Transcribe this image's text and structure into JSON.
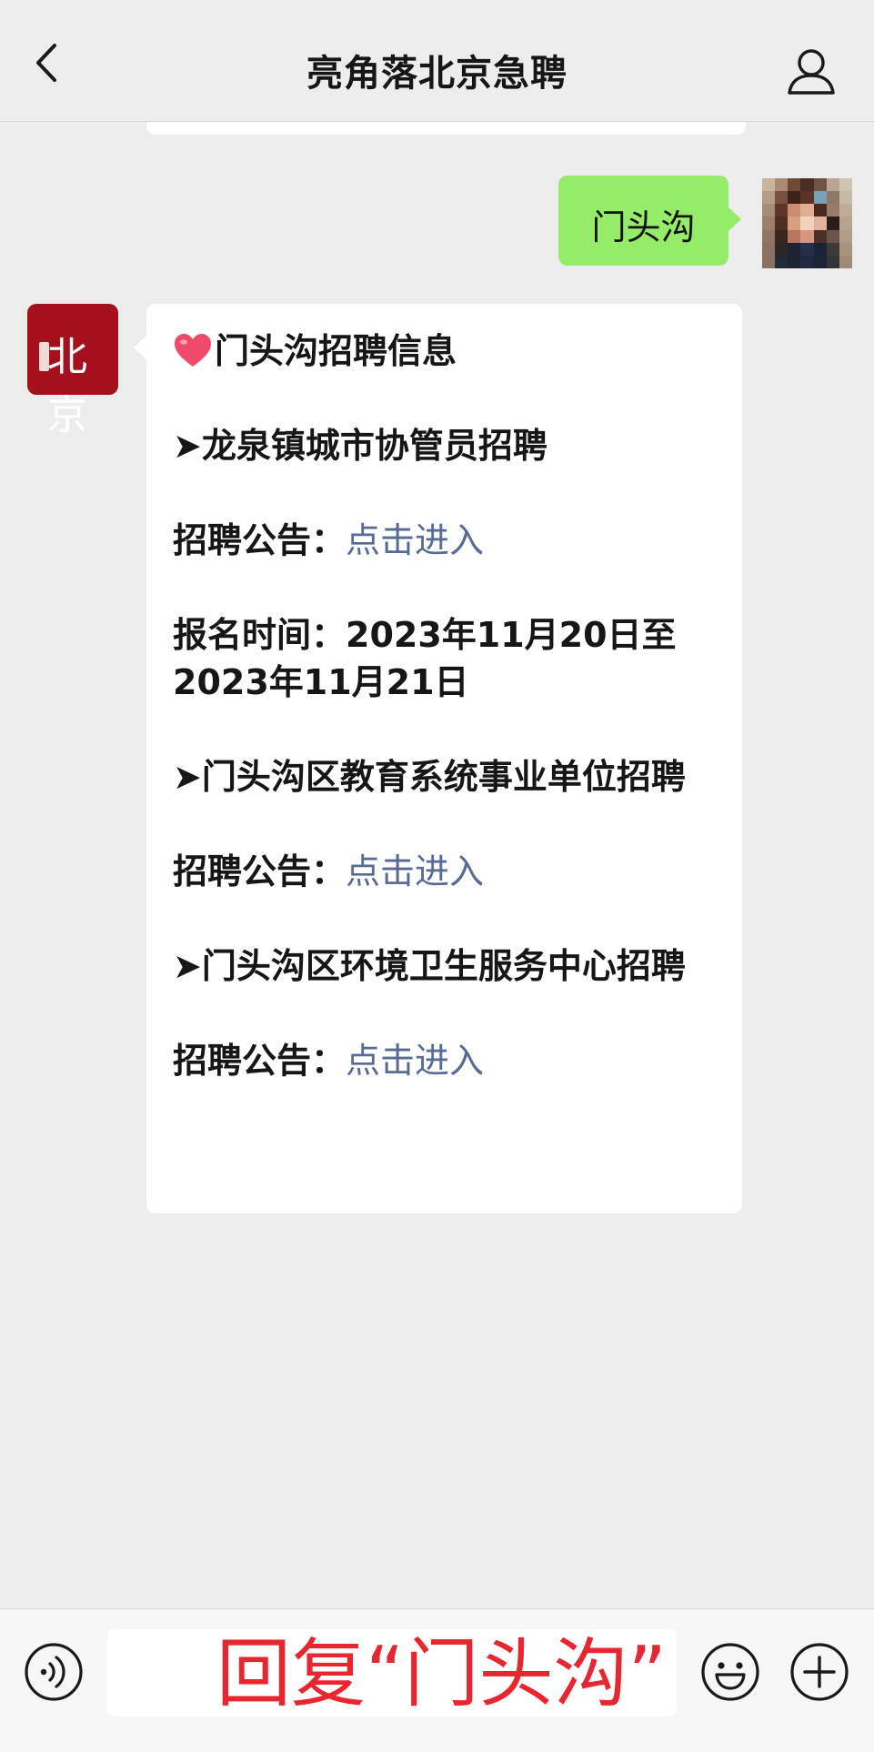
{
  "header": {
    "title": "亮角落北京急聘",
    "back_icon": "chevron-left-icon",
    "profile_icon": "person-icon"
  },
  "outgoing_message": {
    "text": "门头沟",
    "bubble_color": "#95ec69"
  },
  "bot_avatar": {
    "logo_text": "北京",
    "color": "#a4101c"
  },
  "incoming_message": {
    "title_icon": "heart-icon",
    "title": "门头沟招聘信息",
    "section1_heading": "➤龙泉镇城市协管员招聘",
    "section1_notice_label": "招聘公告：",
    "section1_notice_link": "点击进入",
    "section1_signup": "报名时间：2023年11月20日至2023年11月21日",
    "section2_heading": "➤门头沟区教育系统事业单位招聘",
    "section2_notice_label": "招聘公告：",
    "section2_notice_link": "点击进入",
    "section3_heading": "➤门头沟区环境卫生服务中心招聘",
    "section3_notice_label": "招聘公告：",
    "section3_notice_link": "点击进入",
    "link_color": "#576b95"
  },
  "input_bar": {
    "voice_icon": "voice-icon",
    "input_value": "回复“门头沟”",
    "input_text_color": "#e8262f",
    "emoji_icon": "emoji-icon",
    "plus_icon": "plus-icon"
  }
}
